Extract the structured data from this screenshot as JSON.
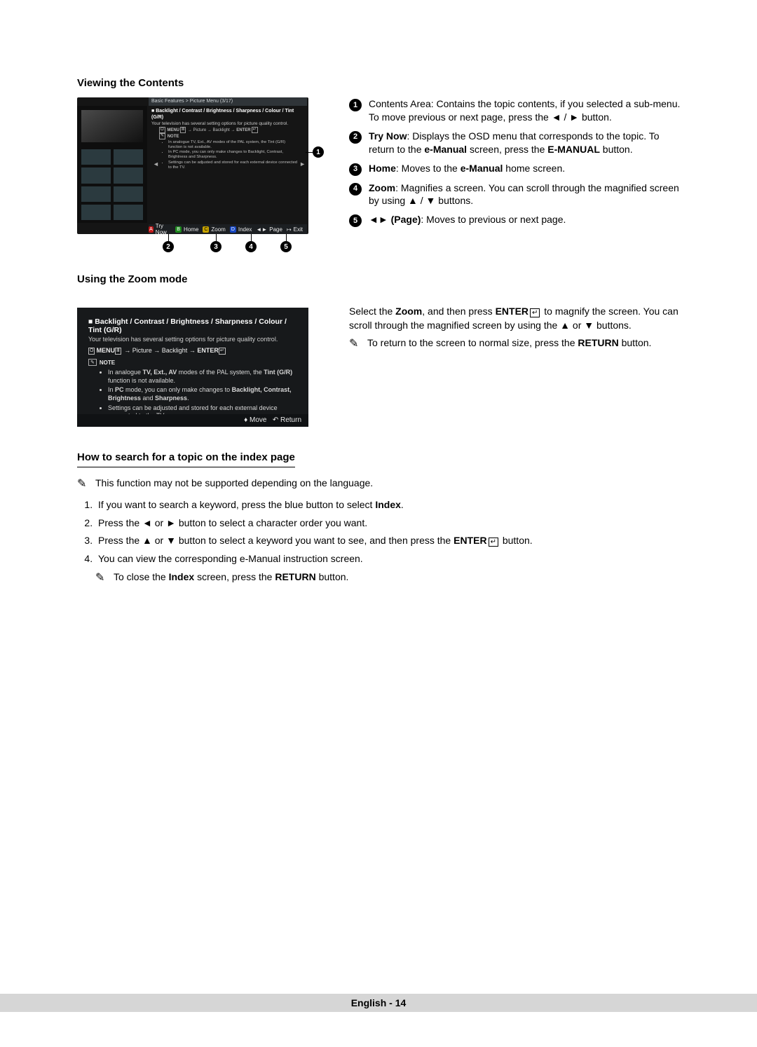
{
  "headings": {
    "viewing": "Viewing the Contents",
    "zoom": "Using the Zoom mode",
    "search": "How to search for a topic on the index page"
  },
  "screen1": {
    "breadcrumb": "Basic Features > Picture Menu (3/17)",
    "title_prefix": "■  ",
    "title": "Backlight / Contrast / Brightness / Sharpness / Colour / Tint (G/R)",
    "subtitle": "Your television has several setting options for picture quality control.",
    "menu_path": "MENU → Picture → Backlight → ENTER",
    "note_label": "NOTE",
    "notes": [
      "In analogue TV, Ext., AV modes of the PAL system, the Tint (G/R) function is not available.",
      "In PC mode, you can only make changes to Backlight, Contrast, Brightness and Sharpness.",
      "Settings can be adjusted and stored for each external device connected to the TV."
    ],
    "bar": {
      "a": "Try Now",
      "b": "Home",
      "c": "Zoom",
      "d": "Index",
      "page": "Page",
      "exit": "Exit"
    }
  },
  "callouts": {
    "c1": {
      "label": "Contents Area: Contains the topic contents, if you selected a sub-menu. To move previous or next page, press the ◄ / ► button."
    },
    "c2": {
      "lead": "Try Now",
      "rest": ": Displays the OSD menu that corresponds to the topic. To return to the ",
      "bold1": "e-Manual",
      "rest2": " screen, press the ",
      "bold2": "E-MANUAL",
      "rest3": " button."
    },
    "c3": {
      "lead": "Home",
      "rest": ": Moves to the ",
      "bold1": "e-Manual",
      "rest2": " home screen."
    },
    "c4": {
      "lead": "Zoom",
      "rest": ": Magnifies a screen. You can scroll through the magnified screen by using ▲ / ▼ buttons."
    },
    "c5": {
      "lead": "◄► (Page)",
      "rest": ": Moves to previous or next page."
    }
  },
  "screen2": {
    "title_prefix": "■  ",
    "title": "Backlight / Contrast / Brightness / Sharpness / Colour / Tint (G/R)",
    "subtitle": "Your television has several setting options for picture quality control.",
    "menu_path_pre": "MENU",
    "menu_path_mid": " → Picture → Backlight → ",
    "menu_path_post": "ENTER",
    "note_label": "NOTE",
    "notes": {
      "n1_pre": "In analogue ",
      "n1_b1": "TV, Ext., AV",
      "n1_mid": " modes of the PAL system, the ",
      "n1_b2": "Tint (G/R)",
      "n1_post": " function is not available.",
      "n2_pre": "In ",
      "n2_b1": "PC",
      "n2_mid": " mode, you can only make changes to ",
      "n2_b2": "Backlight, Contrast, Brightness",
      "n2_mid2": " and ",
      "n2_b3": "Sharpness",
      "n2_post": ".",
      "n3": "Settings can be adjusted and stored for each external device connected to the TV."
    },
    "bar": {
      "move": "Move",
      "return": "Return"
    }
  },
  "zoom_right": {
    "p_pre": "Select the ",
    "p_b1": "Zoom",
    "p_mid": ", and then press ",
    "p_b2": "ENTER",
    "p_mid2": " to magnify the screen. You can scroll through the magnified screen by using the ▲ or ▼ buttons.",
    "note_pre": "To return to the screen to normal size, press the ",
    "note_b": "RETURN",
    "note_post": "  button."
  },
  "search": {
    "note": "This function may not be supported depending on the language.",
    "s1_pre": "If you want to search a keyword, press the blue button to select ",
    "s1_b": "Index",
    "s1_post": ".",
    "s2": "Press the ◄ or ► button to select a character order you want.",
    "s3_pre": "Press the ▲ or ▼ button to select a keyword you want to see, and then press the ",
    "s3_b": "ENTER",
    "s3_post": " button.",
    "s4": "You can view the corresponding e-Manual instruction screen.",
    "closing_pre": "To close the ",
    "closing_b1": "Index",
    "closing_mid": " screen, press the ",
    "closing_b2": "RETURN",
    "closing_post": " button."
  },
  "footer": "English - 14"
}
